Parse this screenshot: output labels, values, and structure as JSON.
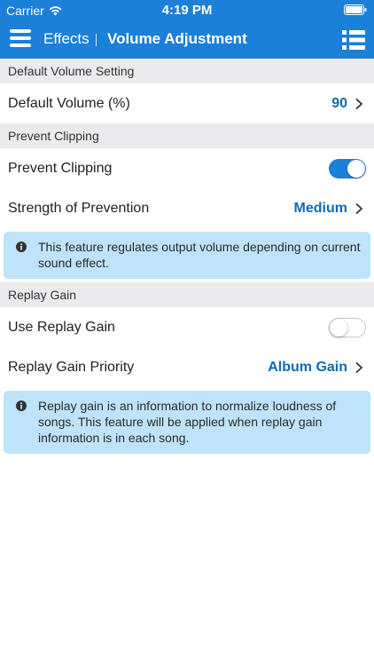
{
  "status_bar": {
    "carrier": "Carrier",
    "time": "4:19 PM"
  },
  "nav": {
    "back_label": "Effects",
    "title": "Volume Adjustment"
  },
  "sections": {
    "default_volume": {
      "header": "Default Volume Setting",
      "row_label": "Default Volume (%)",
      "row_value": "90"
    },
    "prevent_clipping": {
      "header": "Prevent Clipping",
      "toggle_label": "Prevent Clipping",
      "toggle_on": true,
      "strength_label": "Strength of Prevention",
      "strength_value": "Medium",
      "info": "This feature regulates output volume depending on current sound effect."
    },
    "replay_gain": {
      "header": "Replay Gain",
      "toggle_label": "Use Replay Gain",
      "toggle_on": false,
      "priority_label": "Replay Gain Priority",
      "priority_value": "Album Gain",
      "info": "Replay gain is an information to normalize loudness of songs. This feature will be applied when replay gain information is in each song."
    }
  },
  "colors": {
    "accent": "#1c7fd8",
    "value_text": "#0f6ab4",
    "info_bg": "#bfe3fa",
    "section_bg": "#ebebed"
  },
  "icons": [
    "wifi-icon",
    "battery-icon",
    "hamburger-menu-icon",
    "list-icon",
    "chevron-right-icon",
    "info-icon"
  ]
}
